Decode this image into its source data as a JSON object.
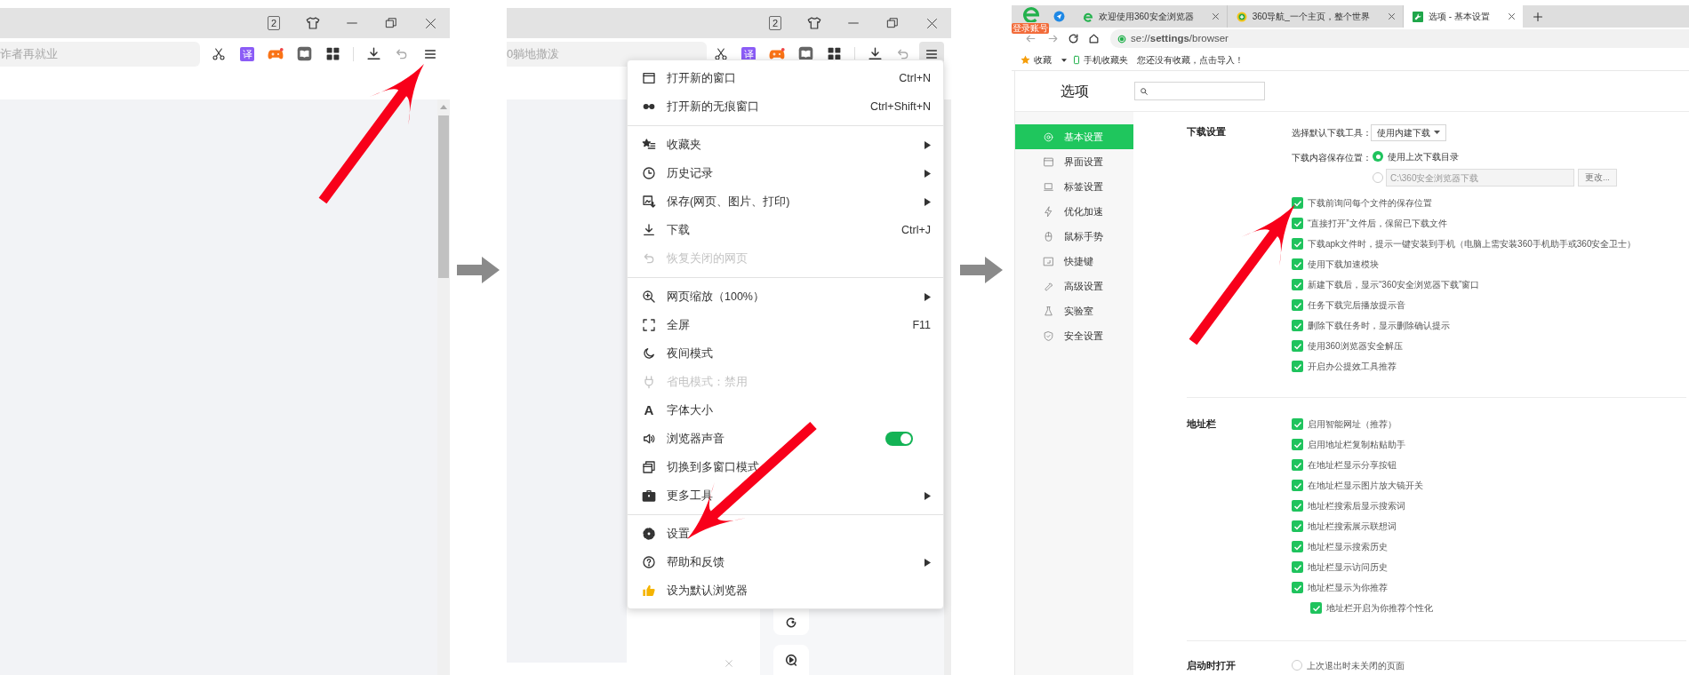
{
  "panel_1": {
    "tab_count": "2",
    "address_text": "诈者再就业",
    "translate_badge": "译",
    "menu_open": false
  },
  "panel_2": {
    "tab_count": "2",
    "address_text": "0躺地撒泼",
    "translate_badge": "译",
    "menu_open": true,
    "menu": [
      {
        "kind": "item",
        "label": "打开新的窗口",
        "shortcut": "Ctrl+N",
        "submenu": false,
        "disabled": false
      },
      {
        "kind": "item",
        "label": "打开新的无痕窗口",
        "shortcut": "Ctrl+Shift+N",
        "submenu": false,
        "disabled": false
      },
      {
        "kind": "separator"
      },
      {
        "kind": "item",
        "label": "收藏夹",
        "submenu": true,
        "disabled": false
      },
      {
        "kind": "item",
        "label": "历史记录",
        "submenu": true,
        "disabled": false
      },
      {
        "kind": "item",
        "label": "保存(网页、图片、打印)",
        "submenu": true,
        "disabled": false
      },
      {
        "kind": "item",
        "label": "下载",
        "shortcut": "Ctrl+J",
        "submenu": false,
        "disabled": false
      },
      {
        "kind": "item",
        "label": "恢复关闭的网页",
        "submenu": false,
        "disabled": true
      },
      {
        "kind": "separator"
      },
      {
        "kind": "item",
        "label": "网页缩放（100%）",
        "submenu": true,
        "disabled": false
      },
      {
        "kind": "item",
        "label": "全屏",
        "shortcut": "F11",
        "submenu": false,
        "disabled": false
      },
      {
        "kind": "item",
        "label": "夜间模式",
        "submenu": false,
        "disabled": false
      },
      {
        "kind": "item",
        "label": "省电模式：禁用",
        "submenu": false,
        "disabled": true
      },
      {
        "kind": "item",
        "label": "字体大小",
        "icon_text": "A",
        "submenu": false,
        "disabled": false
      },
      {
        "kind": "toggle",
        "label": "浏览器声音",
        "on": true,
        "submenu": false,
        "disabled": false
      },
      {
        "kind": "item",
        "label": "切换到多窗口模式",
        "submenu": false,
        "disabled": false
      },
      {
        "kind": "item",
        "label": "更多工具",
        "submenu": true,
        "disabled": false
      },
      {
        "kind": "separator"
      },
      {
        "kind": "item",
        "label": "设置",
        "submenu": false,
        "disabled": false
      },
      {
        "kind": "item",
        "label": "帮助和反馈",
        "submenu": true,
        "disabled": false
      },
      {
        "kind": "item",
        "label": "设为默认浏览器",
        "submenu": false,
        "disabled": false
      }
    ]
  },
  "panel_3": {
    "login_badge": "登录账号",
    "tabs": [
      {
        "title": "欢迎使用360安全浏览器",
        "selected": false
      },
      {
        "title": "360导航_一个主页，整个世界",
        "selected": false
      },
      {
        "title": "选项 - 基本设置",
        "selected": true
      }
    ],
    "url": "se://**settings**/browser",
    "bookmarks_bar": {
      "favorites": "收藏",
      "mobile_favorites": "手机收藏夹",
      "hint": "您还没有收藏，点击导入！"
    },
    "title": "选项",
    "sidebar": [
      {
        "label": "基本设置",
        "selected": true
      },
      {
        "label": "界面设置",
        "selected": false
      },
      {
        "label": "标签设置",
        "selected": false
      },
      {
        "label": "优化加速",
        "selected": false
      },
      {
        "label": "鼠标手势",
        "selected": false
      },
      {
        "label": "快捷键",
        "selected": false
      },
      {
        "label": "高级设置",
        "selected": false
      },
      {
        "label": "实验室",
        "selected": false
      },
      {
        "label": "安全设置",
        "selected": false
      }
    ],
    "sections": [
      {
        "title": "下载设置",
        "rows": [
          {
            "kind": "dropdown",
            "label": "选择默认下载工具：",
            "value": "使用内建下载"
          },
          {
            "kind": "radio_group",
            "label": "下载内容保存位置：",
            "options": [
              {
                "label": "使用上次下载目录",
                "selected": true
              },
              {
                "path": "C:\\360安全浏览器下载",
                "button": "更改...",
                "selected": false
              }
            ]
          },
          {
            "kind": "checkbox",
            "label": "下载前询问每个文件的保存位置",
            "checked": true
          },
          {
            "kind": "checkbox",
            "label": "“直接打开”文件后，保留已下载文件",
            "checked": true
          },
          {
            "kind": "checkbox",
            "label": "下载apk文件时，提示一键安装到手机（电脑上需安装360手机助手或360安全卫士）",
            "checked": true
          },
          {
            "kind": "checkbox",
            "label": "使用下载加速模块",
            "checked": true
          },
          {
            "kind": "checkbox",
            "label": "新建下载后，显示“360安全浏览器下载”窗口",
            "checked": true
          },
          {
            "kind": "checkbox",
            "label": "任务下载完后播放提示音",
            "checked": true
          },
          {
            "kind": "checkbox",
            "label": "删除下载任务时，显示删除确认提示",
            "checked": true
          },
          {
            "kind": "checkbox",
            "label": "使用360浏览器安全解压",
            "checked": true
          },
          {
            "kind": "checkbox",
            "label": "开启办公提效工具推荐",
            "checked": true
          }
        ]
      },
      {
        "title": "地址栏",
        "rows": [
          {
            "kind": "checkbox",
            "label": "启用智能网址（推荐）",
            "checked": true
          },
          {
            "kind": "checkbox",
            "label": "启用地址栏复制粘贴助手",
            "checked": true
          },
          {
            "kind": "checkbox",
            "label": "在地址栏显示分享按钮",
            "checked": true
          },
          {
            "kind": "checkbox",
            "label": "在地址栏显示图片放大镜开关",
            "checked": true
          },
          {
            "kind": "checkbox",
            "label": "地址栏搜索后显示搜索词",
            "checked": true
          },
          {
            "kind": "checkbox",
            "label": "地址栏搜索展示联想词",
            "checked": true
          },
          {
            "kind": "checkbox",
            "label": "地址栏显示搜索历史",
            "checked": true
          },
          {
            "kind": "checkbox",
            "label": "地址栏显示访问历史",
            "checked": true
          },
          {
            "kind": "checkbox",
            "label": "地址栏显示为你推荐",
            "checked": true,
            "children": [
              {
                "kind": "checkbox",
                "label": "地址栏开启为你推荐个性化",
                "checked": true
              }
            ]
          }
        ]
      },
      {
        "title": "启动时打开",
        "rows": [
          {
            "kind": "radio",
            "label": "上次退出时未关闭的页面",
            "selected": false
          }
        ]
      }
    ]
  }
}
